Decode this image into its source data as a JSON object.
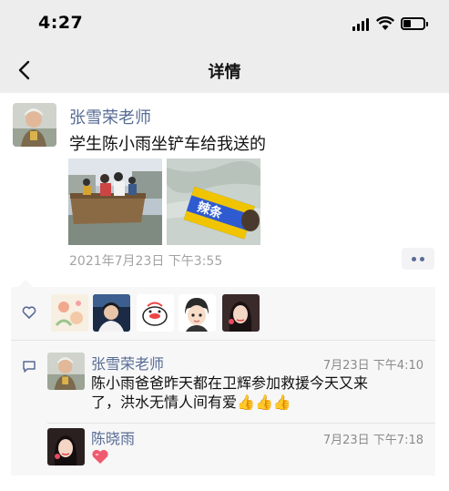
{
  "status_bar": {
    "time": "4:27"
  },
  "nav": {
    "title": "详情"
  },
  "post": {
    "author": "张雪荣老师",
    "text": "学生陈小雨坐铲车给我送的",
    "timestamp": "2021年7月23日 下午3:55",
    "photos": [
      "photo-loader-rescue",
      "photo-water-snacks"
    ]
  },
  "likes": {
    "count": 5
  },
  "comments": [
    {
      "name": "张雪荣老师",
      "time": "7月23日 下午4:10",
      "line1": "陈小雨爸爸昨天都在卫辉参加救援今天又来",
      "line2": "了，洪水无情人间有爱",
      "thumbs": "👍👍👍"
    },
    {
      "name": "陈晓雨",
      "time": "7月23日 下午7:18",
      "emoji": "heart"
    }
  ],
  "colors": {
    "link": "#576b95",
    "header_bg": "#ededed",
    "box_bg": "#f7f7f7",
    "gray_text": "#a3a3a3"
  }
}
